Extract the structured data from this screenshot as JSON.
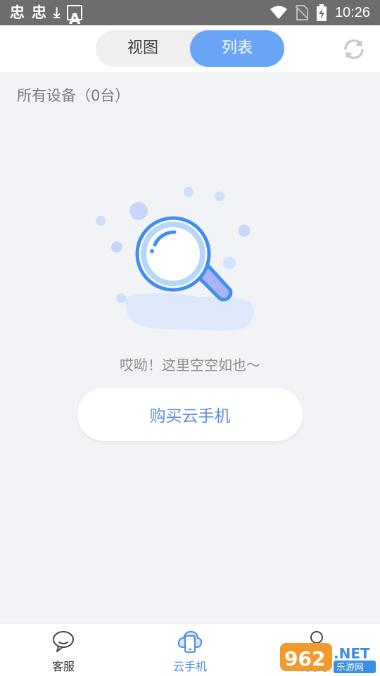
{
  "status_bar": {
    "left_glyph_1": "忠",
    "left_glyph_2": "忠",
    "download_glyph": "⤓",
    "a_glyph": "A",
    "time": "10:26"
  },
  "top_tabs": {
    "view_label": "视图",
    "list_label": "列表",
    "active": "列表",
    "active_color": "#6aa4f6"
  },
  "device_count": "所有设备（0台）",
  "empty_state": {
    "message": "哎呦！这里空空如也～",
    "buy_button_label": "购买云手机"
  },
  "bottom_nav": {
    "items": [
      {
        "label": "客服",
        "icon": "chat-bubble-icon"
      },
      {
        "label": "云手机",
        "icon": "cloud-phone-icon",
        "active": true
      },
      {
        "label": "我的",
        "icon": "user-icon"
      }
    ],
    "active_color": "#4b8de8"
  },
  "watermark": {
    "text_main": "962.NET",
    "text_sub": "乐游网"
  }
}
